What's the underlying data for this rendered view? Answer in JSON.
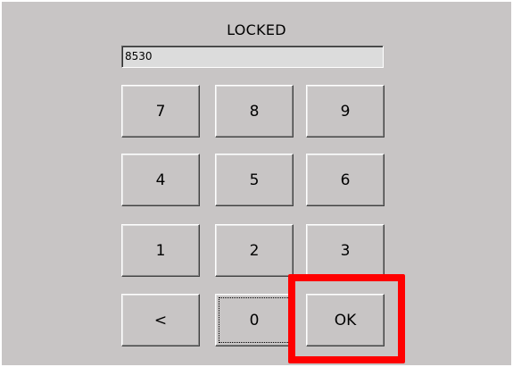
{
  "title": "LOCKED",
  "display": {
    "value": "8530"
  },
  "keypad": {
    "k7": "7",
    "k8": "8",
    "k9": "9",
    "k4": "4",
    "k5": "5",
    "k6": "6",
    "k1": "1",
    "k2": "2",
    "k3": "3",
    "back": "<",
    "k0": "0",
    "ok": "OK"
  },
  "highlight_color": "#ff0000"
}
